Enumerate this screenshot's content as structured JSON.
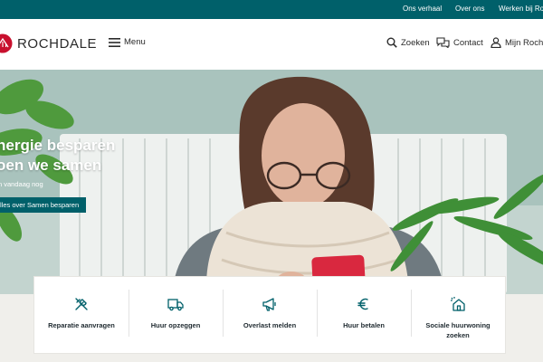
{
  "topbar": {
    "links": [
      {
        "label": "Ons verhaal"
      },
      {
        "label": "Over ons"
      },
      {
        "label": "Werken bij Rochdale"
      }
    ]
  },
  "header": {
    "logo_text": "ROCHDALE",
    "menu_label": "Menu",
    "nav": [
      {
        "label": "Zoeken",
        "icon": "search-icon"
      },
      {
        "label": "Contact",
        "icon": "chat-icon"
      },
      {
        "label": "Mijn Rochdale",
        "icon": "user-icon"
      }
    ]
  },
  "hero": {
    "title_line1": "nergie besparen",
    "title_line2": "oen we samen",
    "subtitle": "n vandaag nog",
    "cta": "lles over Samen besparen"
  },
  "tiles": [
    {
      "label": "Reparatie aanvragen",
      "icon": "tools-icon"
    },
    {
      "label": "Huur opzeggen",
      "icon": "moving-truck-icon"
    },
    {
      "label": "Overlast melden",
      "icon": "megaphone-icon"
    },
    {
      "label": "Huur betalen",
      "icon": "euro-icon"
    },
    {
      "label": "Sociale huurwoning zoeken",
      "icon": "house-search-icon"
    }
  ],
  "colors": {
    "brand_teal": "#00606a",
    "logo_red": "#c8102e",
    "hero_bg": "#a9c3bd",
    "page_bg": "#f0efeb"
  }
}
